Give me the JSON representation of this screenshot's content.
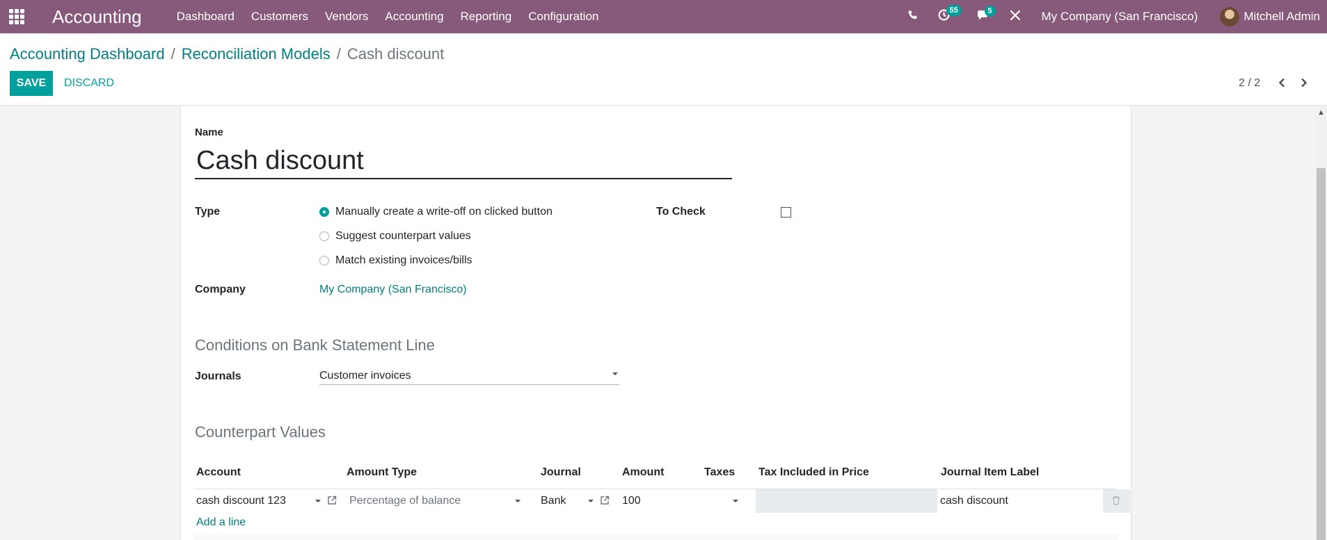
{
  "navbar": {
    "app_name": "Accounting",
    "menu": [
      "Dashboard",
      "Customers",
      "Vendors",
      "Accounting",
      "Reporting",
      "Configuration"
    ],
    "activity_count": "55",
    "message_count": "5",
    "company": "My Company (San Francisco)",
    "user": "Mitchell Admin",
    "icons": [
      "apps-grid-icon",
      "phone-icon",
      "clock-icon",
      "chat-icon",
      "tools-icon"
    ]
  },
  "breadcrumb": {
    "items": [
      "Accounting Dashboard",
      "Reconciliation Models"
    ],
    "current": "Cash discount",
    "separator": "/"
  },
  "buttons": {
    "save": "Save",
    "discard": "Discard"
  },
  "pager": {
    "value": "2 / 2"
  },
  "form": {
    "name_label": "Name",
    "name_value": "Cash discount",
    "type_label": "Type",
    "type_options": [
      "Manually create a write-off on clicked button",
      "Suggest counterpart values",
      "Match existing invoices/bills"
    ],
    "type_selected": 0,
    "to_check_label": "To Check",
    "to_check": false,
    "company_label": "Company",
    "company_value": "My Company (San Francisco)"
  },
  "conditions": {
    "title": "Conditions on Bank Statement Line",
    "journals_label": "Journals",
    "journals_value": "Customer invoices"
  },
  "counterpart": {
    "title": "Counterpart Values",
    "columns": [
      "Account",
      "Amount Type",
      "Journal",
      "Amount",
      "Taxes",
      "Tax Included in Price",
      "Journal Item Label"
    ],
    "row": {
      "account": "cash discount 123",
      "amount_type": "Percentage of balance",
      "journal": "Bank",
      "amount": "100",
      "taxes": "",
      "journal_item_label": "cash discount"
    },
    "add_line": "Add a line"
  },
  "colors": {
    "navbar": "#875a7b",
    "accent": "#00a09d",
    "link": "#017e84"
  }
}
